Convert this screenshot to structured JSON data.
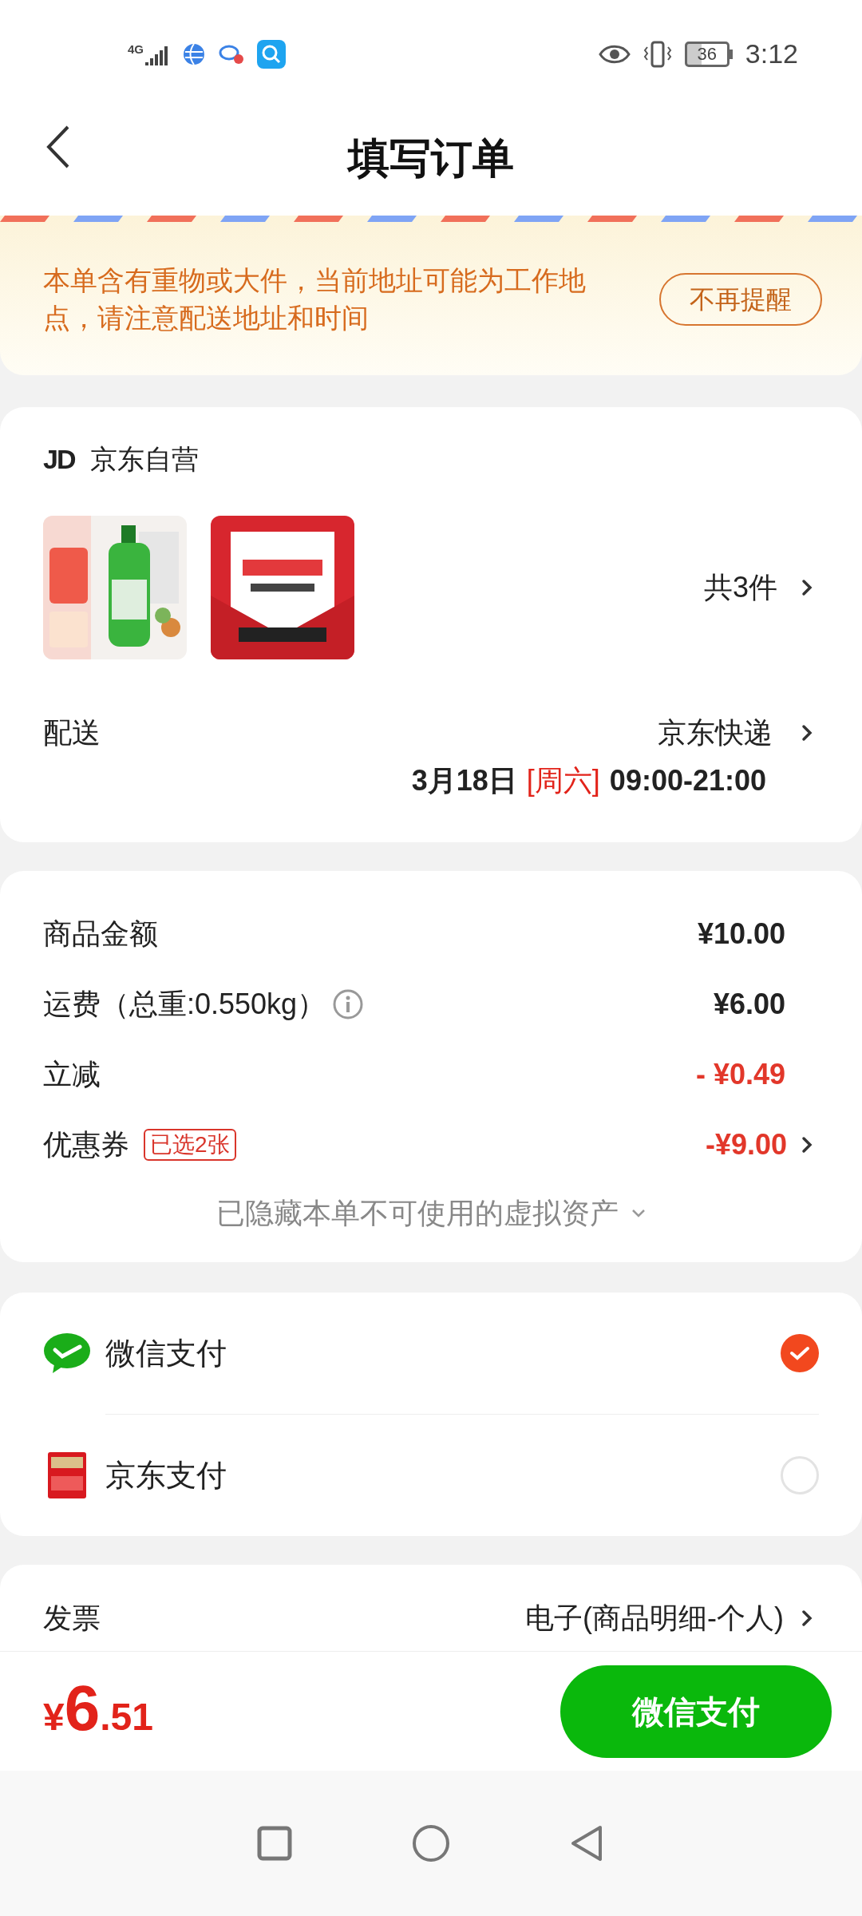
{
  "status_bar": {
    "network": "4G",
    "battery": "36",
    "time": "3:12"
  },
  "header": {
    "title": "填写订单"
  },
  "notice": {
    "text": "本单含有重物或大件，当前地址可能为工作地点，请注意配送地址和时间",
    "button": "不再提醒"
  },
  "shop": {
    "logo": "JD",
    "name": "京东自营"
  },
  "products": {
    "count": "共3件"
  },
  "delivery": {
    "label": "配送",
    "carrier": "京东快递",
    "date": "3月18日",
    "weekday": "[周六]",
    "time": "09:00-21:00"
  },
  "fees": [
    {
      "label": "商品金额",
      "value": "¥10.00",
      "kind": "normal"
    },
    {
      "label": "运费（总重:0.550kg）",
      "value": "¥6.00",
      "kind": "normal",
      "info": true
    },
    {
      "label": "立减",
      "value": "- ¥0.49",
      "kind": "discount"
    },
    {
      "label": "优惠券",
      "tag": "已选2张",
      "value": "-¥9.00",
      "kind": "discount",
      "arrow": true
    }
  ],
  "hidden_assets": "已隐藏本单不可使用的虚拟资产",
  "payment": [
    {
      "name": "微信支付",
      "kind": "wechat",
      "selected": true
    },
    {
      "name": "京东支付",
      "kind": "jdpay",
      "selected": false
    }
  ],
  "invoice": {
    "label": "发票",
    "value": "电子(商品明细-个人)"
  },
  "bottom_bar": {
    "currency": "¥",
    "integer": "6",
    "decimal": ".51",
    "button": "微信支付"
  }
}
